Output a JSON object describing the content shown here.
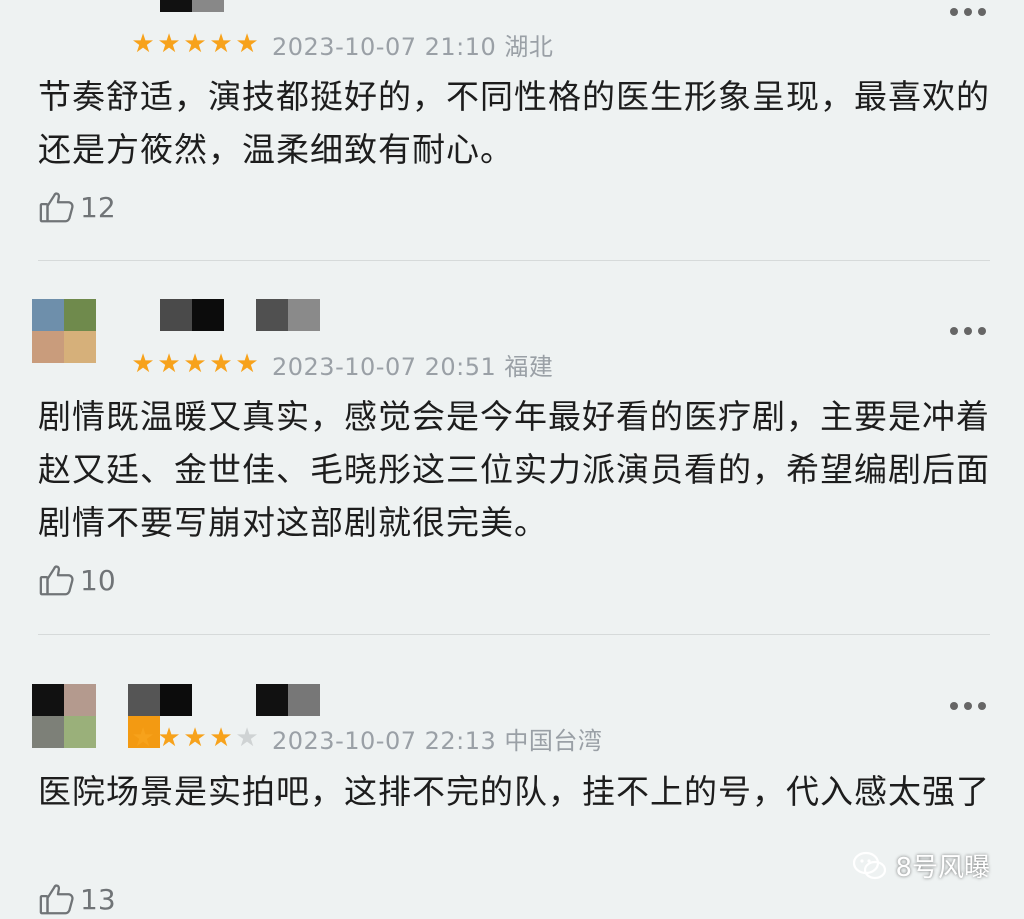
{
  "reviews": [
    {
      "rating": 5,
      "date": "2023-10-07 21:10",
      "location": "湖北",
      "text": "节奏舒适，演技都挺好的，不同性格的医生形象呈现，最喜欢的还是方筱然，温柔细致有耐心。",
      "likes": "12"
    },
    {
      "rating": 5,
      "date": "2023-10-07 20:51",
      "location": "福建",
      "text": "剧情既温暖又真实，感觉会是今年最好看的医疗剧，主要是冲着赵又廷、金世佳、毛晓彤这三位实力派演员看的，希望编剧后面剧情不要写崩对这部剧就很完美。",
      "likes": "10"
    },
    {
      "rating": 4,
      "date": "2023-10-07 22:13",
      "location": "中国台湾",
      "text": "医院场景是实拍吧，这排不完的队，挂不上的号，代入感太强了",
      "likes": "13"
    }
  ],
  "watermark": "8号风曝",
  "colors": {
    "star_on": "#f7a21b",
    "star_off": "#cfd3d4",
    "meta_text": "#9aa0a6",
    "background": "#eef2f2"
  },
  "icons": {
    "like": "thumbs-up-icon",
    "more": "more-dots-icon",
    "watermark": "wechat-icon"
  }
}
